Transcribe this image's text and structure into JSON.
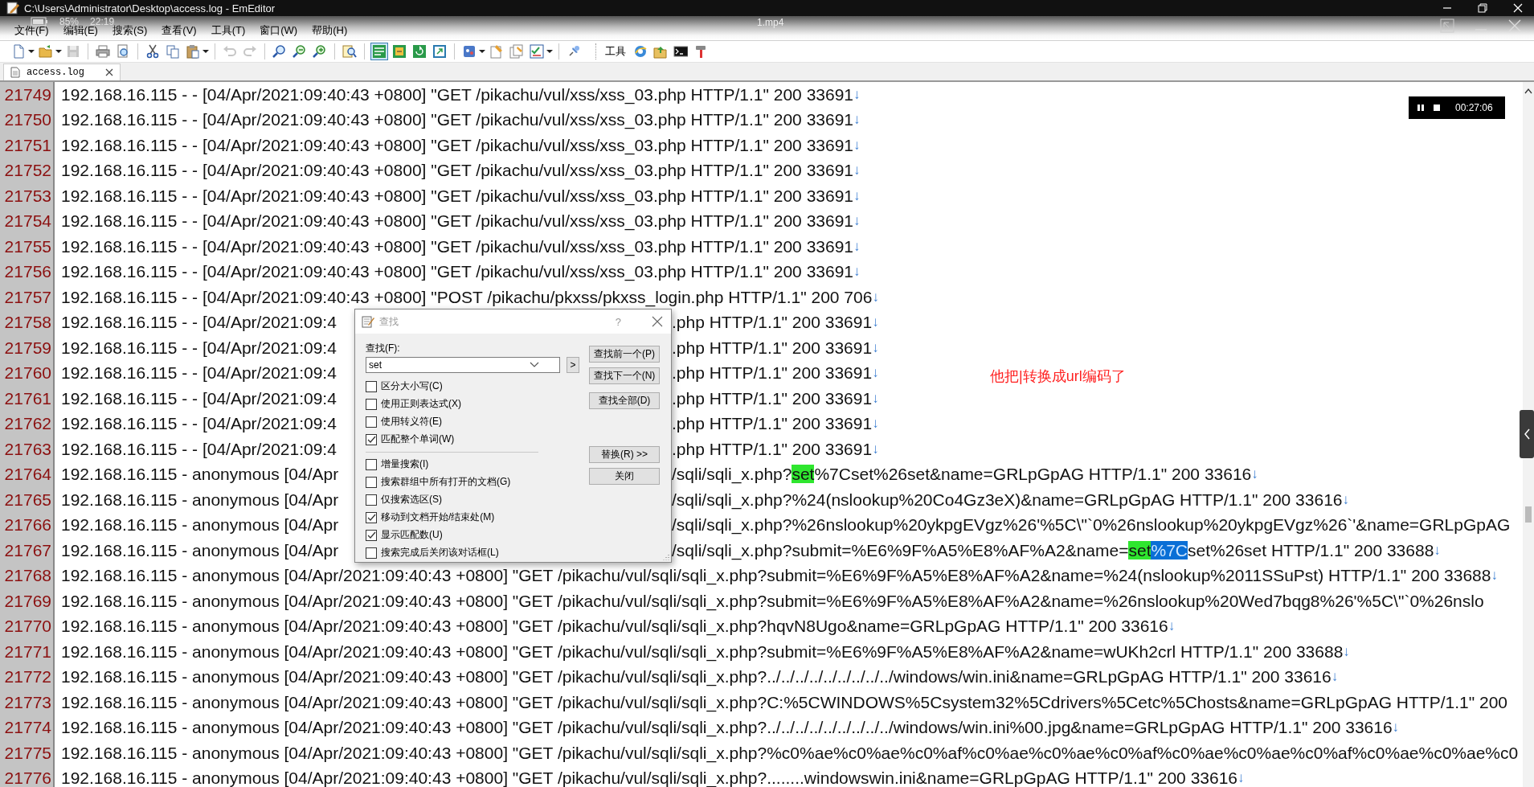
{
  "window": {
    "title": "C:\\Users\\Administrator\\Desktop\\access.log - EmEditor"
  },
  "player_overlay": {
    "battery": "85%",
    "clock": "22:19",
    "file": "1.mp4",
    "time": "00:27:06"
  },
  "menu": [
    "文件(F)",
    "编辑(E)",
    "搜索(S)",
    "查看(V)",
    "工具(T)",
    "窗口(W)",
    "帮助(H)"
  ],
  "toolbar": [
    {
      "kind": "new",
      "pressed": false,
      "disabled": false
    },
    {
      "kind": "caret"
    },
    {
      "kind": "open",
      "pressed": false,
      "disabled": false
    },
    {
      "kind": "caret"
    },
    {
      "kind": "save",
      "pressed": false,
      "disabled": true
    },
    {
      "kind": "separator"
    },
    {
      "kind": "print",
      "pressed": false,
      "disabled": false
    },
    {
      "kind": "preview",
      "pressed": false,
      "disabled": false
    },
    {
      "kind": "separator"
    },
    {
      "kind": "cut",
      "pressed": false,
      "disabled": false
    },
    {
      "kind": "copy",
      "pressed": false,
      "disabled": false
    },
    {
      "kind": "paste",
      "pressed": false,
      "disabled": false
    },
    {
      "kind": "caret"
    },
    {
      "kind": "separator"
    },
    {
      "kind": "undo",
      "pressed": false,
      "disabled": true
    },
    {
      "kind": "redo",
      "pressed": false,
      "disabled": true
    },
    {
      "kind": "separator"
    },
    {
      "kind": "find",
      "pressed": false,
      "disabled": false
    },
    {
      "kind": "find-next",
      "pressed": false,
      "disabled": false
    },
    {
      "kind": "find-prev",
      "pressed": false,
      "disabled": false
    },
    {
      "kind": "separator"
    },
    {
      "kind": "find-files",
      "pressed": false,
      "disabled": false
    },
    {
      "kind": "separator"
    },
    {
      "kind": "wrap",
      "pressed": true,
      "disabled": false
    },
    {
      "kind": "window-a",
      "pressed": false,
      "disabled": false
    },
    {
      "kind": "window-b",
      "pressed": false,
      "disabled": false
    },
    {
      "kind": "window-c",
      "pressed": false,
      "disabled": false
    },
    {
      "kind": "separator"
    },
    {
      "kind": "macro",
      "pressed": false,
      "disabled": false
    },
    {
      "kind": "caret"
    },
    {
      "kind": "note-a",
      "pressed": false,
      "disabled": false
    },
    {
      "kind": "note-b",
      "pressed": false,
      "disabled": false
    },
    {
      "kind": "checklist",
      "pressed": false,
      "disabled": false
    },
    {
      "kind": "caret"
    },
    {
      "kind": "separator"
    },
    {
      "kind": "pin",
      "pressed": false,
      "disabled": false
    }
  ],
  "tools_toolbar": {
    "label": "工具",
    "items": [
      {
        "kind": "browser"
      },
      {
        "kind": "folder-up"
      },
      {
        "kind": "console"
      },
      {
        "kind": "hammer"
      }
    ]
  },
  "tabs": [
    {
      "label": "access.log",
      "selected": true
    }
  ],
  "lines": [
    {
      "number": "21749",
      "text": [
        {
          "text": "192.168.16.115 - - [04/Apr/2021:09:40:43 +0800] \"GET /pikachu/vul/xss/xss_03.php HTTP/1.1\" 200 33691",
          "matched": false,
          "selected": false
        }
      ],
      "eol": "↓"
    },
    {
      "number": "21750",
      "text": [
        {
          "text": "192.168.16.115 - - [04/Apr/2021:09:40:43 +0800] \"GET /pikachu/vul/xss/xss_03.php HTTP/1.1\" 200 33691",
          "matched": false,
          "selected": false
        }
      ],
      "eol": "↓"
    },
    {
      "number": "21751",
      "text": [
        {
          "text": "192.168.16.115 - - [04/Apr/2021:09:40:43 +0800] \"GET /pikachu/vul/xss/xss_03.php HTTP/1.1\" 200 33691",
          "matched": false,
          "selected": false
        }
      ],
      "eol": "↓"
    },
    {
      "number": "21752",
      "text": [
        {
          "text": "192.168.16.115 - - [04/Apr/2021:09:40:43 +0800] \"GET /pikachu/vul/xss/xss_03.php HTTP/1.1\" 200 33691",
          "matched": false,
          "selected": false
        }
      ],
      "eol": "↓"
    },
    {
      "number": "21753",
      "text": [
        {
          "text": "192.168.16.115 - - [04/Apr/2021:09:40:43 +0800] \"GET /pikachu/vul/xss/xss_03.php HTTP/1.1\" 200 33691",
          "matched": false,
          "selected": false
        }
      ],
      "eol": "↓"
    },
    {
      "number": "21754",
      "text": [
        {
          "text": "192.168.16.115 - - [04/Apr/2021:09:40:43 +0800] \"GET /pikachu/vul/xss/xss_03.php HTTP/1.1\" 200 33691",
          "matched": false,
          "selected": false
        }
      ],
      "eol": "↓"
    },
    {
      "number": "21755",
      "text": [
        {
          "text": "192.168.16.115 - - [04/Apr/2021:09:40:43 +0800] \"GET /pikachu/vul/xss/xss_03.php HTTP/1.1\" 200 33691",
          "matched": false,
          "selected": false
        }
      ],
      "eol": "↓"
    },
    {
      "number": "21756",
      "text": [
        {
          "text": "192.168.16.115 - - [04/Apr/2021:09:40:43 +0800] \"GET /pikachu/vul/xss/xss_03.php HTTP/1.1\" 200 33691",
          "matched": false,
          "selected": false
        }
      ],
      "eol": "↓"
    },
    {
      "number": "21757",
      "text": [
        {
          "text": "192.168.16.115 - - [04/Apr/2021:09:40:43 +0800] \"POST /pikachu/pkxss/pkxss_login.php HTTP/1.1\" 200 706",
          "matched": false,
          "selected": false
        }
      ],
      "eol": "↓"
    },
    {
      "number": "21758",
      "text": [
        {
          "text": "192.168.16.115 - - [04/Apr/2021:09:4",
          "matched": false,
          "selected": false
        }
      ],
      "after": [
        {
          "text": ".php HTTP/1.1\" 200 33691",
          "matched": false,
          "selected": false
        }
      ],
      "eol": "↓"
    },
    {
      "number": "21759",
      "text": [
        {
          "text": "192.168.16.115 - - [04/Apr/2021:09:4",
          "matched": false,
          "selected": false
        }
      ],
      "after": [
        {
          "text": ".php HTTP/1.1\" 200 33691",
          "matched": false,
          "selected": false
        }
      ],
      "eol": "↓"
    },
    {
      "number": "21760",
      "text": [
        {
          "text": "192.168.16.115 - - [04/Apr/2021:09:4",
          "matched": false,
          "selected": false
        }
      ],
      "after": [
        {
          "text": ".php HTTP/1.1\" 200 33691",
          "matched": false,
          "selected": false
        }
      ],
      "eol": "↓"
    },
    {
      "number": "21761",
      "text": [
        {
          "text": "192.168.16.115 - - [04/Apr/2021:09:4",
          "matched": false,
          "selected": false
        }
      ],
      "after": [
        {
          "text": ".php HTTP/1.1\" 200 33691",
          "matched": false,
          "selected": false
        }
      ],
      "eol": "↓"
    },
    {
      "number": "21762",
      "text": [
        {
          "text": "192.168.16.115 - - [04/Apr/2021:09:4",
          "matched": false,
          "selected": false
        }
      ],
      "after": [
        {
          "text": ".php HTTP/1.1\" 200 33691",
          "matched": false,
          "selected": false
        }
      ],
      "eol": "↓"
    },
    {
      "number": "21763",
      "text": [
        {
          "text": "192.168.16.115 - - [04/Apr/2021:09:4",
          "matched": false,
          "selected": false
        }
      ],
      "after": [
        {
          "text": ".php HTTP/1.1\" 200 33691",
          "matched": false,
          "selected": false
        }
      ],
      "eol": "↓"
    },
    {
      "number": "21764",
      "text": [
        {
          "text": "192.168.16.115 - anonymous [04/Apr",
          "matched": false,
          "selected": false
        }
      ],
      "after": [
        {
          "text": "/sqli/sqli_x.php?",
          "matched": false,
          "selected": false
        },
        {
          "text": "set",
          "matched": true,
          "selected": false
        },
        {
          "text": "%7Cset%26set&name=GRLpGpAG HTTP/1.1\" 200 33616",
          "matched": false,
          "selected": false
        }
      ],
      "eol": "↓"
    },
    {
      "number": "21765",
      "text": [
        {
          "text": "192.168.16.115 - anonymous [04/Apr",
          "matched": false,
          "selected": false
        }
      ],
      "after": [
        {
          "text": "/sqli/sqli_x.php?%24(nslookup%20Co4Gz3eX)&name=GRLpGpAG HTTP/1.1\" 200 33616",
          "matched": false,
          "selected": false
        }
      ],
      "eol": "↓"
    },
    {
      "number": "21766",
      "text": [
        {
          "text": "192.168.16.115 - anonymous [04/Apr",
          "matched": false,
          "selected": false
        }
      ],
      "after": [
        {
          "text": "/sqli/sqli_x.php?%26nslookup%20ykpgEVgz%26'%5C\\\"`0%26nslookup%20ykpgEVgz%26`'&name=GRLpGpAG",
          "matched": false,
          "selected": false
        }
      ]
    },
    {
      "number": "21767",
      "text": [
        {
          "text": "192.168.16.115 - anonymous [04/Apr",
          "matched": false,
          "selected": false
        }
      ],
      "after": [
        {
          "text": "/sqli/sqli_x.php?submit=%E6%9F%A5%E8%AF%A2&name=",
          "matched": false,
          "selected": false
        },
        {
          "text": "set",
          "matched": true,
          "selected": false
        },
        {
          "text": "%7C",
          "matched": false,
          "selected": true
        },
        {
          "text": "set%26set HTTP/1.1\" 200 33688",
          "matched": false,
          "selected": false
        }
      ],
      "eol": "↓"
    },
    {
      "number": "21768",
      "text": [
        {
          "text": "192.168.16.115 - anonymous [04/Apr/2021:09:40:43 +0800] \"GET /pikachu/vul/sqli/sqli_x.php?submit=%E6%9F%A5%E8%AF%A2&name=%24(nslookup%2011SSuPst) HTTP/1.1\" 200 33688",
          "matched": false,
          "selected": false
        }
      ],
      "eol": "↓"
    },
    {
      "number": "21769",
      "text": [
        {
          "text": "192.168.16.115 - anonymous [04/Apr/2021:09:40:43 +0800] \"GET /pikachu/vul/sqli/sqli_x.php?submit=%E6%9F%A5%E8%AF%A2&name=%26nslookup%20Wed7bqg8%26'%5C\\\"`0%26nslo",
          "matched": false,
          "selected": false
        }
      ]
    },
    {
      "number": "21770",
      "text": [
        {
          "text": "192.168.16.115 - anonymous [04/Apr/2021:09:40:43 +0800] \"GET /pikachu/vul/sqli/sqli_x.php?hqvN8Ugo&name=GRLpGpAG HTTP/1.1\" 200 33616",
          "matched": false,
          "selected": false
        }
      ],
      "eol": "↓"
    },
    {
      "number": "21771",
      "text": [
        {
          "text": "192.168.16.115 - anonymous [04/Apr/2021:09:40:43 +0800] \"GET /pikachu/vul/sqli/sqli_x.php?submit=%E6%9F%A5%E8%AF%A2&name=wUKh2crl HTTP/1.1\" 200 33688",
          "matched": false,
          "selected": false
        }
      ],
      "eol": "↓"
    },
    {
      "number": "21772",
      "text": [
        {
          "text": "192.168.16.115 - anonymous [04/Apr/2021:09:40:43 +0800] \"GET /pikachu/vul/sqli/sqli_x.php?../../../../../../../../../windows/win.ini&name=GRLpGpAG HTTP/1.1\" 200 33616",
          "matched": false,
          "selected": false
        }
      ],
      "eol": "↓"
    },
    {
      "number": "21773",
      "text": [
        {
          "text": "192.168.16.115 - anonymous [04/Apr/2021:09:40:43 +0800] \"GET /pikachu/vul/sqli/sqli_x.php?C:%5CWINDOWS%5Csystem32%5Cdrivers%5Cetc%5Chosts&name=GRLpGpAG HTTP/1.1\" 200",
          "matched": false,
          "selected": false
        }
      ]
    },
    {
      "number": "21774",
      "text": [
        {
          "text": "192.168.16.115 - anonymous [04/Apr/2021:09:40:43 +0800] \"GET /pikachu/vul/sqli/sqli_x.php?../../../../../../../../../windows/win.ini%00.jpg&name=GRLpGpAG HTTP/1.1\" 200 33616",
          "matched": false,
          "selected": false
        }
      ],
      "eol": "↓"
    },
    {
      "number": "21775",
      "text": [
        {
          "text": "192.168.16.115 - anonymous [04/Apr/2021:09:40:43 +0800] \"GET /pikachu/vul/sqli/sqli_x.php?%c0%ae%c0%ae%c0%af%c0%ae%c0%ae%c0%af%c0%ae%c0%ae%c0%af%c0%ae%c0%ae%c0",
          "matched": false,
          "selected": false
        }
      ]
    },
    {
      "number": "21776",
      "text": [
        {
          "text": "192.168.16.115 - anonymous [04/Apr/2021:09:40:43 +0800] \"GET /pikachu/vul/sqli/sqli_x.php?........windowswin.ini&name=GRLpGpAG HTTP/1.1\" 200 33616",
          "matched": false,
          "selected": false
        }
      ],
      "eol": "↓"
    }
  ],
  "find_dialog": {
    "title": "查找",
    "help": "?",
    "find_label": "查找(F):",
    "find_value": "set",
    "history_button": ">",
    "option_groups": [
      [
        {
          "label": "区分大小写(C)",
          "checked": false
        },
        {
          "label": "使用正则表达式(X)",
          "checked": false
        },
        {
          "label": "使用转义符(E)",
          "checked": false
        },
        {
          "label": "匹配整个单词(W)",
          "checked": true
        }
      ],
      [
        {
          "label": "增量搜索(I)",
          "checked": false
        },
        {
          "label": "搜索群组中所有打开的文档(G)",
          "checked": false
        },
        {
          "label": "仅搜索选区(S)",
          "checked": false
        },
        {
          "label": "移动到文档开始/结束处(M)",
          "checked": true
        },
        {
          "label": "显示匹配数(U)",
          "checked": true
        },
        {
          "label": "搜索完成后关闭该对话框(L)",
          "checked": false
        }
      ]
    ],
    "button_groups": [
      [
        "查找前一个(P)",
        "查找下一个(N)"
      ],
      [
        "查找全部(D)"
      ],
      [
        "替换(R) >>",
        "关闭"
      ]
    ]
  },
  "annotation": "他把|转换成url编码了"
}
